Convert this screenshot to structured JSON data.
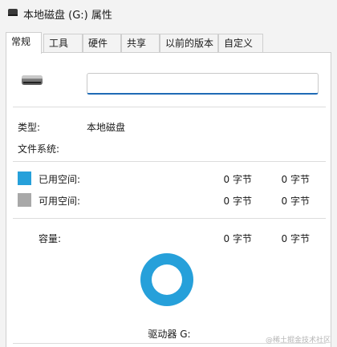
{
  "window": {
    "title": "本地磁盘 (G:) 属性",
    "icon": "drive-icon"
  },
  "tabs": [
    {
      "label": "常规",
      "active": true
    },
    {
      "label": "工具",
      "active": false
    },
    {
      "label": "硬件",
      "active": false
    },
    {
      "label": "共享",
      "active": false
    },
    {
      "label": "以前的版本",
      "active": false
    },
    {
      "label": "自定义",
      "active": false
    }
  ],
  "general": {
    "drive_name_value": "",
    "type_label": "类型:",
    "type_value": "本地磁盘",
    "filesystem_label": "文件系统:",
    "filesystem_value": "",
    "used": {
      "label": "已用空间:",
      "bytes": "0 字节",
      "size": "0 字节",
      "color": "#26a0da"
    },
    "free": {
      "label": "可用空间:",
      "bytes": "0 字节",
      "size": "0 字节",
      "color": "#a8a8a8"
    },
    "capacity": {
      "label": "容量:",
      "bytes": "0 字节",
      "size": "0 字节"
    },
    "drive_label": "驱动器 G:",
    "usage_fraction": 0
  },
  "colors": {
    "accent": "#1f6bb5",
    "donut": "#26a0da"
  },
  "watermark": "@稀土掘金技术社区"
}
